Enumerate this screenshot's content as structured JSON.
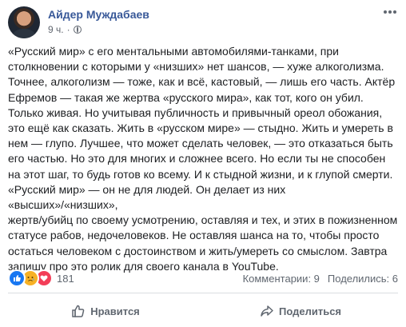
{
  "post": {
    "author": "Айдер Муждабаев",
    "time": "9 ч.",
    "separator": "·",
    "privacy_icon": "globe-icon",
    "more_icon": "ellipsis-icon",
    "text": "«Русский мир» с его ментальными автомобилями-танками, при\nстолкновении с которыми у «низших» нет шансов, — хуже алкоголизма.\nТочнее, алкоголизм — тоже, как и всё, кастовый, — лишь его часть. Актёр\nЕфремов — такая же жертва «русского мира», как тот, кого он убил.\nТолько живая. Но учитывая публичность и привычный ореол обожания,\nэто ещё как сказать. Жить в «русском мире» — стыдно. Жить и умереть в\nнем — глупо. Лучшее, что может сделать человек, — это отказаться быть\nего частью. Но это для многих и сложнее всего. Но если ты не способен\nна этот шаг, то будь готов ко всему. И к стыдной жизни, и к глупой смерти.\n«Русский мир» — он не для людей. Он делает из них «высших»/«низших»,\nжертв/убийц по своему усмотрению, оставляя и тех, и этих в пожизненном\nстатусе рабов, недочеловеков. Не оставляя шанса на то, чтобы просто\nостаться человеком с достоинством и жить/умереть со смыслом. Завтра\nзапишу про это ролик для своего канала в YouTube."
  },
  "reactions": {
    "icons": [
      "like-reaction-icon",
      "sad-reaction-icon",
      "love-reaction-icon"
    ],
    "count": "181",
    "comments": "Комментарии: 9",
    "shares": "Поделились: 6",
    "colors": {
      "like": "#1877f2",
      "sad": "#f7b125",
      "love": "#f33e58"
    }
  },
  "actions": {
    "like_label": "Нравится",
    "share_label": "Поделиться"
  },
  "colors": {
    "author": "#385898",
    "text": "#1c1e21",
    "secondary": "#606770"
  }
}
